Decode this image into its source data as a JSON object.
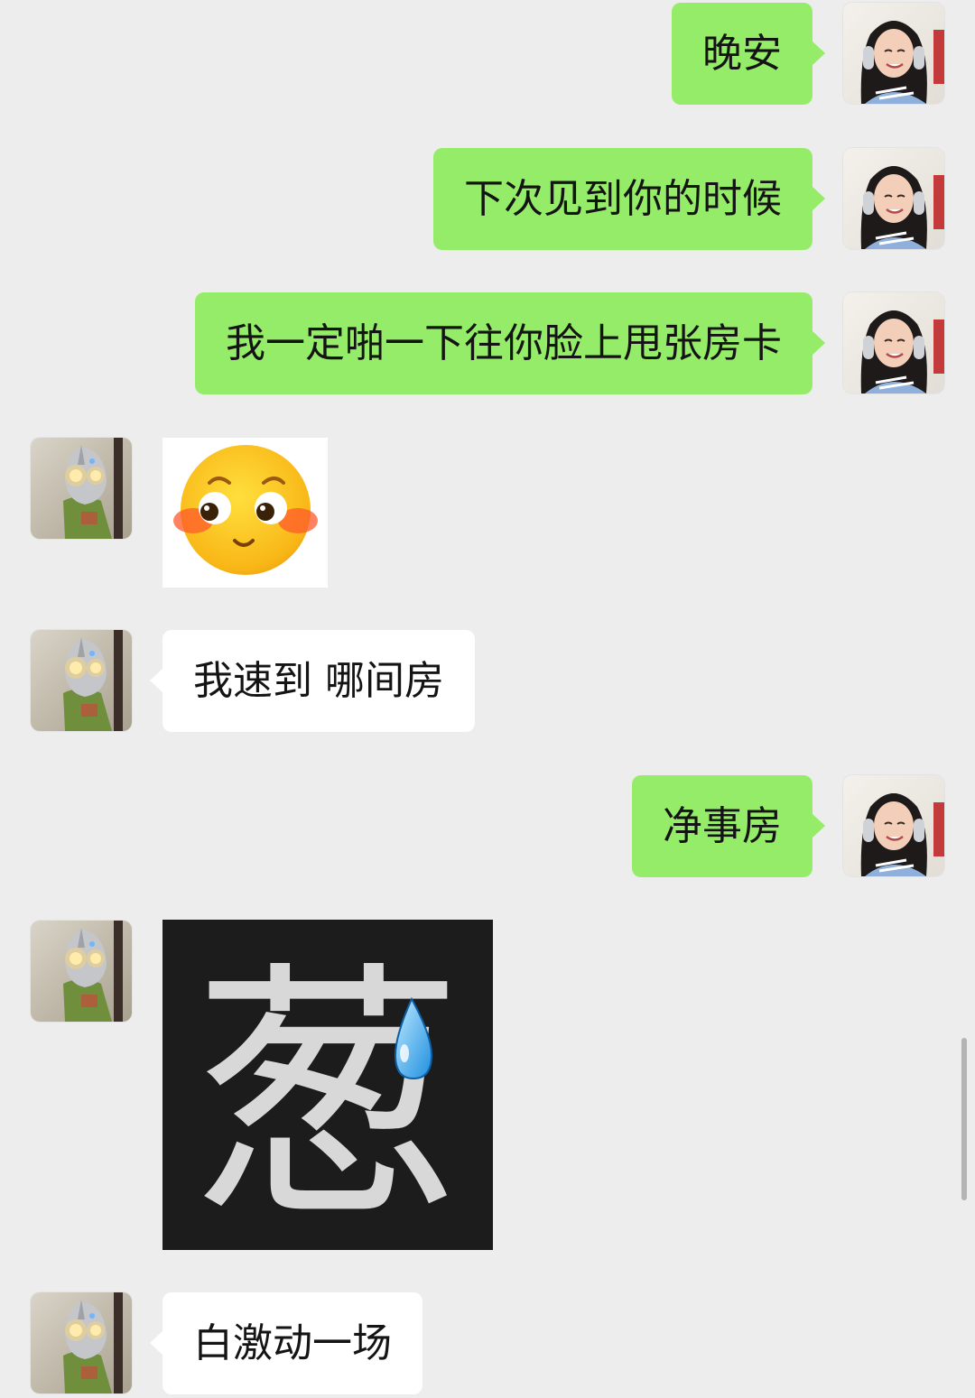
{
  "messages": [
    {
      "sender": "me",
      "type": "text",
      "text": "晚安"
    },
    {
      "sender": "me",
      "type": "text",
      "text": "下次见到你的时候"
    },
    {
      "sender": "me",
      "type": "text",
      "text": "我一定啪一下往你脸上甩张房卡"
    },
    {
      "sender": "other",
      "type": "sticker",
      "sticker": "blushing-face-emoji"
    },
    {
      "sender": "other",
      "type": "text",
      "text": "我速到 哪间房"
    },
    {
      "sender": "me",
      "type": "text",
      "text": "净事房"
    },
    {
      "sender": "other",
      "type": "sticker",
      "sticker": "cong-character-sweat-drop",
      "char": "葱"
    },
    {
      "sender": "other",
      "type": "text",
      "text": "白激动一场"
    }
  ],
  "colors": {
    "chat_background": "#ededed",
    "my_bubble": "#95ec69",
    "other_bubble": "#ffffff",
    "text": "#141414"
  }
}
